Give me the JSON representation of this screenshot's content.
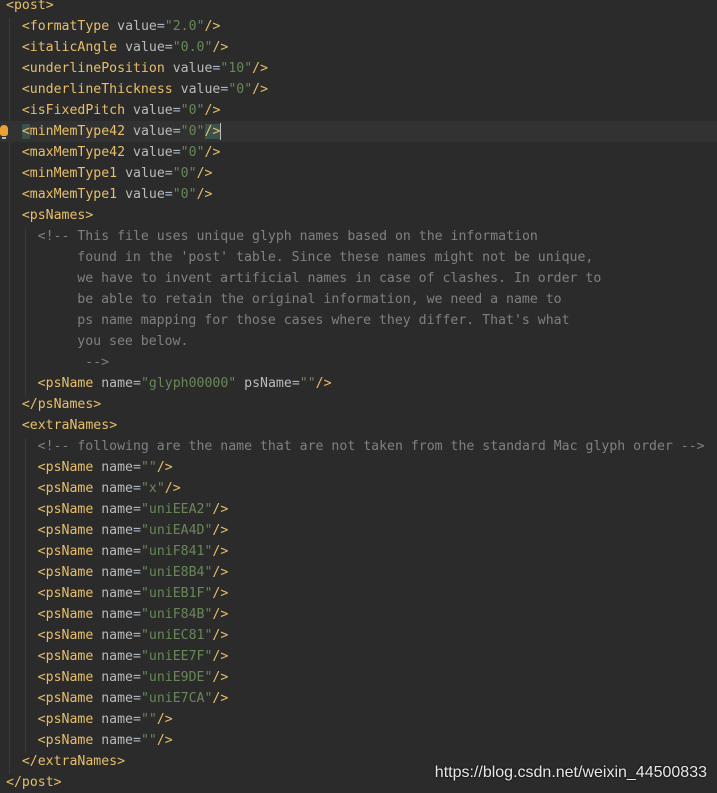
{
  "editor": {
    "lines": [
      {
        "indent": 0,
        "kind": "open",
        "tag": "post"
      },
      {
        "indent": 2,
        "kind": "attr1",
        "tag": "formatType",
        "attr": "value",
        "val": "\"2.0\""
      },
      {
        "indent": 2,
        "kind": "attr1",
        "tag": "italicAngle",
        "attr": "value",
        "val": "\"0.0\""
      },
      {
        "indent": 2,
        "kind": "attr1",
        "tag": "underlinePosition",
        "attr": "value",
        "val": "\"10\""
      },
      {
        "indent": 2,
        "kind": "attr1",
        "tag": "underlineThickness",
        "attr": "value",
        "val": "\"0\""
      },
      {
        "indent": 2,
        "kind": "attr1",
        "tag": "isFixedPitch",
        "attr": "value",
        "val": "\"0\""
      },
      {
        "indent": 2,
        "kind": "attr1",
        "tag": "minMemType42",
        "attr": "value",
        "val": "\"0\"",
        "active": true
      },
      {
        "indent": 2,
        "kind": "attr1",
        "tag": "maxMemType42",
        "attr": "value",
        "val": "\"0\""
      },
      {
        "indent": 2,
        "kind": "attr1",
        "tag": "minMemType1",
        "attr": "value",
        "val": "\"0\""
      },
      {
        "indent": 2,
        "kind": "attr1",
        "tag": "maxMemType1",
        "attr": "value",
        "val": "\"0\""
      },
      {
        "indent": 2,
        "kind": "open",
        "tag": "psNames"
      },
      {
        "indent": 4,
        "kind": "comment",
        "text": "<!-- This file uses unique glyph names based on the information"
      },
      {
        "indent": 9,
        "kind": "comment",
        "text": "found in the 'post' table. Since these names might not be unique,"
      },
      {
        "indent": 9,
        "kind": "comment",
        "text": "we have to invent artificial names in case of clashes. In order to"
      },
      {
        "indent": 9,
        "kind": "comment",
        "text": "be able to retain the original information, we need a name to"
      },
      {
        "indent": 9,
        "kind": "comment",
        "text": "ps name mapping for those cases where they differ. That's what"
      },
      {
        "indent": 9,
        "kind": "comment",
        "text": "you see below."
      },
      {
        "indent": 10,
        "kind": "comment",
        "text": "-->"
      },
      {
        "indent": 4,
        "kind": "attr2",
        "tag": "psName",
        "attr": "name",
        "val": "\"glyph00000\"",
        "attr2": "psName",
        "val2": "\"\""
      },
      {
        "indent": 2,
        "kind": "close",
        "tag": "psNames"
      },
      {
        "indent": 2,
        "kind": "open",
        "tag": "extraNames"
      },
      {
        "indent": 4,
        "kind": "comment",
        "text": "<!-- following are the name that are not taken from the standard Mac glyph order -->"
      },
      {
        "indent": 4,
        "kind": "attr1",
        "tag": "psName",
        "attr": "name",
        "val": "\"\""
      },
      {
        "indent": 4,
        "kind": "attr1",
        "tag": "psName",
        "attr": "name",
        "val": "\"x\""
      },
      {
        "indent": 4,
        "kind": "attr1",
        "tag": "psName",
        "attr": "name",
        "val": "\"uniEEA2\""
      },
      {
        "indent": 4,
        "kind": "attr1",
        "tag": "psName",
        "attr": "name",
        "val": "\"uniEA4D\""
      },
      {
        "indent": 4,
        "kind": "attr1",
        "tag": "psName",
        "attr": "name",
        "val": "\"uniF841\""
      },
      {
        "indent": 4,
        "kind": "attr1",
        "tag": "psName",
        "attr": "name",
        "val": "\"uniE8B4\""
      },
      {
        "indent": 4,
        "kind": "attr1",
        "tag": "psName",
        "attr": "name",
        "val": "\"uniEB1F\""
      },
      {
        "indent": 4,
        "kind": "attr1",
        "tag": "psName",
        "attr": "name",
        "val": "\"uniF84B\""
      },
      {
        "indent": 4,
        "kind": "attr1",
        "tag": "psName",
        "attr": "name",
        "val": "\"uniEC81\""
      },
      {
        "indent": 4,
        "kind": "attr1",
        "tag": "psName",
        "attr": "name",
        "val": "\"uniEE7F\""
      },
      {
        "indent": 4,
        "kind": "attr1",
        "tag": "psName",
        "attr": "name",
        "val": "\"uniE9DE\""
      },
      {
        "indent": 4,
        "kind": "attr1",
        "tag": "psName",
        "attr": "name",
        "val": "\"uniE7CA\""
      },
      {
        "indent": 4,
        "kind": "attr1",
        "tag": "psName",
        "attr": "name",
        "val": "\"\""
      },
      {
        "indent": 4,
        "kind": "attr1",
        "tag": "psName",
        "attr": "name",
        "val": "\"\""
      },
      {
        "indent": 2,
        "kind": "close",
        "tag": "extraNames"
      },
      {
        "indent": 0,
        "kind": "close",
        "tag": "post"
      }
    ]
  },
  "watermark": "https://blog.csdn.net/weixin_44500833",
  "colors": {
    "background": "#2b2b2b",
    "tag": "#e8bf6a",
    "attribute": "#bababa",
    "string": "#6a8759",
    "comment": "#808080",
    "active_line": "#323232",
    "intention_bulb": "#e9a233"
  },
  "icons": {
    "gutter": "intention-bulb-icon"
  }
}
